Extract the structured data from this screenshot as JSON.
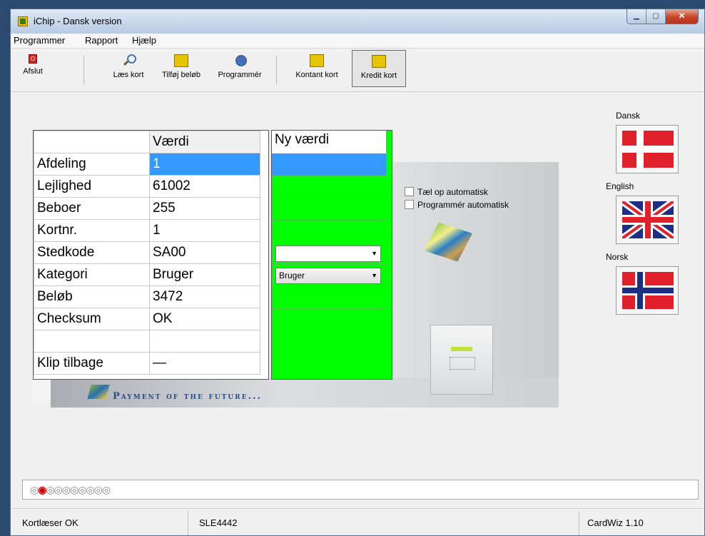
{
  "window": {
    "title": "iChip  -  Dansk version"
  },
  "menu": [
    "Programmer",
    "Rapport",
    "Hjælp"
  ],
  "toolbar": {
    "afslut": "Afslut",
    "laes": "Læs kort",
    "tilfoj": "Tilføj beløb",
    "programmer": "Programmér",
    "kontant": "Kontant kort",
    "kredit": "Kredit kort"
  },
  "grid": {
    "header_value": "Værdi",
    "header_new": "Ny værdi",
    "rows": [
      {
        "label": "Afdeling",
        "value": "1"
      },
      {
        "label": "Lejlighed",
        "value": "61002"
      },
      {
        "label": "Beboer",
        "value": "255"
      },
      {
        "label": "Kortnr.",
        "value": "1"
      },
      {
        "label": "Stedkode",
        "value": "SA00"
      },
      {
        "label": "Kategori",
        "value": "Bruger"
      },
      {
        "label": "Beløb",
        "value": "3472"
      },
      {
        "label": "Checksum",
        "value": "OK"
      },
      {
        "label": "",
        "value": ""
      },
      {
        "label": "Klip tilbage",
        "value": "—"
      }
    ],
    "kategori_select": "Bruger"
  },
  "options": {
    "tael_op": "Tæl op automatisk",
    "programmer_auto": "Programmér automatisk"
  },
  "banner": {
    "text": "Payment of the future..."
  },
  "languages": {
    "dansk": "Dansk",
    "english": "English",
    "norsk": "Norsk"
  },
  "status": {
    "reader": "Kortlæser OK",
    "chip": "SLE4442",
    "version": "CardWiz 1.10"
  },
  "colors": {
    "selection": "#3399ff",
    "new_value_bg": "#00ff00",
    "flag_red": "#e0202a"
  }
}
